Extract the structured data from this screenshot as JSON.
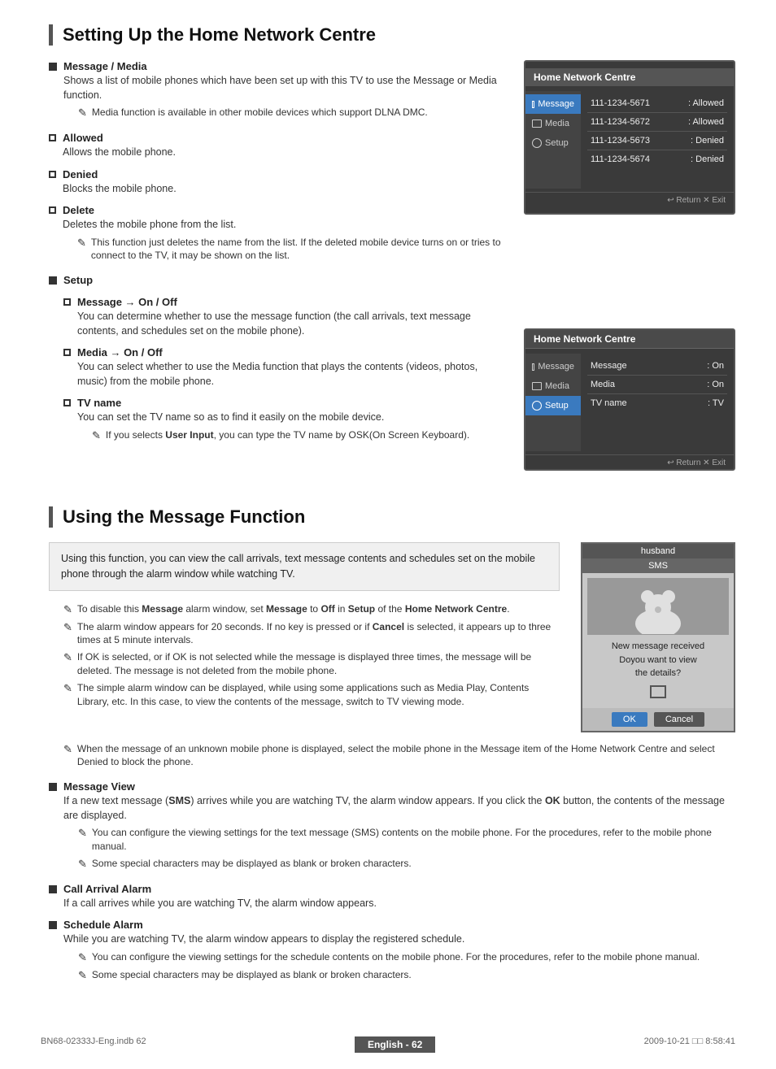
{
  "page": {
    "section1_title": "Setting Up the Home Network Centre",
    "section2_title": "Using the Message Function",
    "footer_left": "BN68-02333J-Eng.indb   62",
    "footer_center": "English - 62",
    "footer_right": "2009-10-21   □□ 8:58:41"
  },
  "message_media": {
    "heading": "Message / Media",
    "desc": "Shows a list of mobile phones which have been set up with this TV to use the Message or Media function.",
    "note1": "Media function is available in other mobile devices which support DLNA DMC."
  },
  "allowed": {
    "heading": "Allowed",
    "desc": "Allows the mobile phone."
  },
  "denied": {
    "heading": "Denied",
    "desc": "Blocks the mobile phone."
  },
  "delete": {
    "heading": "Delete",
    "desc": "Deletes the mobile phone from the list.",
    "note1": "This function just deletes the name from the list. If the deleted mobile device turns on or tries to connect to the TV, it may be shown on the list."
  },
  "setup": {
    "heading": "Setup"
  },
  "msg_on_off": {
    "heading": "Message → On / Off",
    "desc": "You can determine whether to use the message function (the call arrivals, text message contents, and schedules set on the mobile phone)."
  },
  "media_on_off": {
    "heading": "Media → On / Off",
    "desc": "You can select whether to use the Media function that plays the contents (videos, photos, music) from the mobile phone."
  },
  "tv_name": {
    "heading": "TV name",
    "desc": "You can set the TV name so as to find it easily on the mobile device.",
    "note1": "If you selects User Input, you can type the TV name by OSK(On Screen Keyboard)."
  },
  "tv_panel1": {
    "title": "Home Network Centre",
    "sidebar": [
      "Message",
      "Media",
      "Setup"
    ],
    "active": "Message",
    "rows": [
      {
        "number": "111-1234-5671",
        "status": "Allowed"
      },
      {
        "number": "111-1234-5672",
        "status": "Allowed"
      },
      {
        "number": "111-1234-5673",
        "status": "Denied"
      },
      {
        "number": "111-1234-5674",
        "status": "Denied"
      }
    ],
    "footer": "↩ Return   ✕ Exit"
  },
  "tv_panel2": {
    "title": "Home Network Centre",
    "sidebar": [
      "Message",
      "Media",
      "Setup"
    ],
    "active": "Setup",
    "rows": [
      {
        "label": "Message",
        "value": "On"
      },
      {
        "label": "Media",
        "value": "On"
      },
      {
        "label": "TV name",
        "value": "TV"
      }
    ],
    "footer": "↩ Return   ✕ Exit"
  },
  "using_msg": {
    "intro": "Using this function, you can view the call arrivals, text message contents and schedules set on the mobile phone through the alarm window while watching TV.",
    "notes": [
      "To disable this Message alarm window, set Message to Off in Setup of the Home Network Centre.",
      "The alarm window appears for 20 seconds. If no key is pressed or if Cancel is selected, it appears up to three times at 5 minute intervals.",
      "If OK is selected, or if OK is not selected while the message is displayed three times, the message will be deleted. The message is not deleted from the mobile phone.",
      "The simple alarm window can be displayed, while using some applications such as Media Play, Contents Library, etc. In this case, to view the contents of the message, switch to TV viewing mode.",
      "When the message of an unknown mobile phone is displayed, select the mobile phone in the Message item of the Home Network Centre and select Denied to block the phone."
    ]
  },
  "sms_popup": {
    "caller": "husband",
    "type": "SMS",
    "line1": "New message received",
    "line2": "Doyou want to view",
    "line3": "the details?",
    "ok": "OK",
    "cancel": "Cancel"
  },
  "message_view": {
    "heading": "Message View",
    "desc": "If a new text message (SMS) arrives while you are watching TV, the alarm window appears. If you click the OK button, the contents of the message are displayed.",
    "note1": "You can configure the viewing settings for the text message (SMS) contents on the mobile phone. For the procedures, refer to the mobile phone manual.",
    "note2": "Some special characters may be displayed as blank or broken characters."
  },
  "call_arrival": {
    "heading": "Call Arrival Alarm",
    "desc": "If a call arrives while you are watching TV, the alarm window appears."
  },
  "schedule_alarm": {
    "heading": "Schedule Alarm",
    "desc": "While you are watching TV, the alarm window appears to display the registered schedule.",
    "note1": "You can configure the viewing settings for the schedule contents on the mobile phone. For the procedures, refer to the mobile phone manual.",
    "note2": "Some special characters may be displayed as blank or broken characters."
  }
}
